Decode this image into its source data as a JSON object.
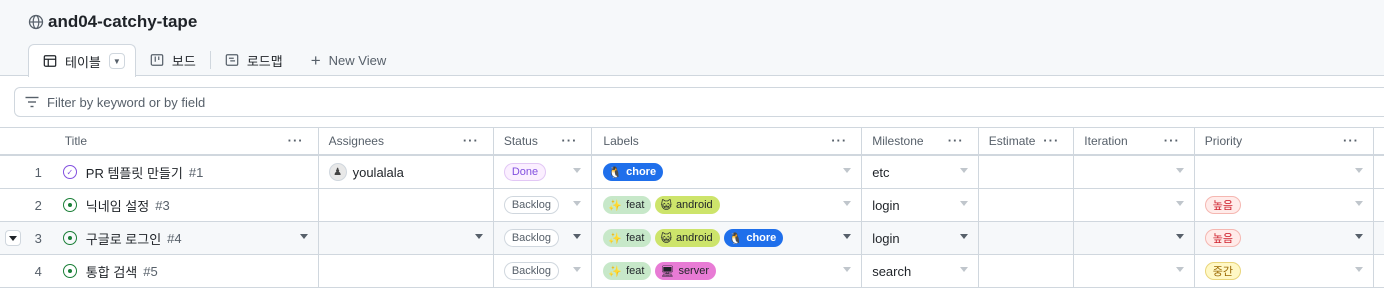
{
  "project": {
    "title": "and04-catchy-tape"
  },
  "tabs": [
    {
      "label": "테이블",
      "icon": "table-icon"
    },
    {
      "label": "보드",
      "icon": "board-icon"
    },
    {
      "label": "로드맵",
      "icon": "roadmap-icon"
    },
    {
      "label": "New View",
      "icon": "plus-icon"
    }
  ],
  "filter": {
    "placeholder": "Filter by keyword or by field"
  },
  "columns": [
    "Title",
    "Assignees",
    "Status",
    "Labels",
    "Milestone",
    "Estimate",
    "Iteration",
    "Priority"
  ],
  "rows": [
    {
      "num": "1",
      "title": "PR 템플릿 만들기",
      "issue": "#1",
      "state": "closed",
      "assignee": "youlalala",
      "status": "Done",
      "labels": [
        {
          "name": "chore",
          "kind": "chore",
          "emoji": "🐧"
        }
      ],
      "milestone": "etc",
      "priority": ""
    },
    {
      "num": "2",
      "title": "닉네임 설정",
      "issue": "#3",
      "state": "open",
      "assignee": "",
      "status": "Backlog",
      "labels": [
        {
          "name": "feat",
          "kind": "feat",
          "emoji": "✨"
        },
        {
          "name": "android",
          "kind": "android",
          "emoji": "😺"
        }
      ],
      "milestone": "login",
      "priority": "높음"
    },
    {
      "num": "3",
      "title": "구글로 로그인",
      "issue": "#4",
      "state": "open",
      "assignee": "",
      "status": "Backlog",
      "labels": [
        {
          "name": "feat",
          "kind": "feat",
          "emoji": "✨"
        },
        {
          "name": "android",
          "kind": "android",
          "emoji": "😺"
        },
        {
          "name": "chore",
          "kind": "chore",
          "emoji": "🐧"
        }
      ],
      "milestone": "login",
      "priority": "높음"
    },
    {
      "num": "4",
      "title": "통합 검색",
      "issue": "#5",
      "state": "open",
      "assignee": "",
      "status": "Backlog",
      "labels": [
        {
          "name": "feat",
          "kind": "feat",
          "emoji": "✨"
        },
        {
          "name": "server",
          "kind": "server",
          "emoji": "🖥"
        }
      ],
      "milestone": "search",
      "priority": "중간"
    }
  ],
  "colors": {
    "chore": "#1f6feb",
    "feat": "#c7e8c9",
    "android": "#cde46b",
    "server": "#e87bd5",
    "open": "#1a7f37",
    "done": "#8250df"
  }
}
